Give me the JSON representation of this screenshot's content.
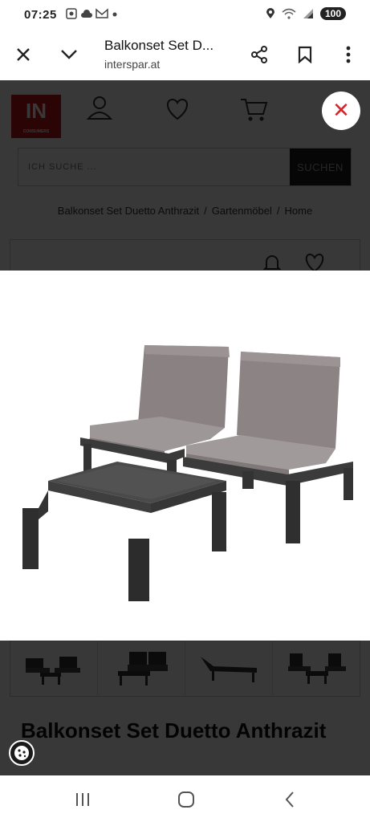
{
  "status_bar": {
    "time": "07:25",
    "battery": "100",
    "left_icons": [
      "screenshot-icon",
      "cloud-icon",
      "gmail-icon",
      "dot-icon"
    ],
    "right_icons": [
      "location-icon",
      "wifi-icon",
      "signal-icon"
    ]
  },
  "browser": {
    "page_title": "Balkonset Set D...",
    "url": "interspar.at",
    "icons": [
      "close-icon",
      "chevron-down-icon",
      "share-icon",
      "bookmark-icon",
      "more-vert-icon"
    ]
  },
  "site": {
    "logo_text": "IN",
    "logo_subtext": "CONSUMERS",
    "header_icons": [
      "user-icon",
      "heart-icon",
      "cart-icon"
    ],
    "search": {
      "placeholder": "ICH SUCHE ...",
      "button_label": "SUCHEN"
    },
    "breadcrumb": [
      "Balkonset Set Duetto Anthrazit",
      "Gartenmöbel",
      "Home"
    ],
    "breadcrumb_separator": "/"
  },
  "lightbox": {
    "close_icon": "close-icon",
    "prev_icon": "chevron-left-icon",
    "next_icon": "chevron-right-icon",
    "accent_color": "#d8232a"
  },
  "thumbnails": [
    {
      "name": "thumb-set-small"
    },
    {
      "name": "thumb-set-front"
    },
    {
      "name": "thumb-lounger"
    },
    {
      "name": "thumb-set-side"
    }
  ],
  "product": {
    "title": "Balkonset Set Duetto Anthrazit"
  },
  "android_nav": {
    "icons": [
      "recents-icon",
      "home-icon",
      "back-icon"
    ]
  }
}
